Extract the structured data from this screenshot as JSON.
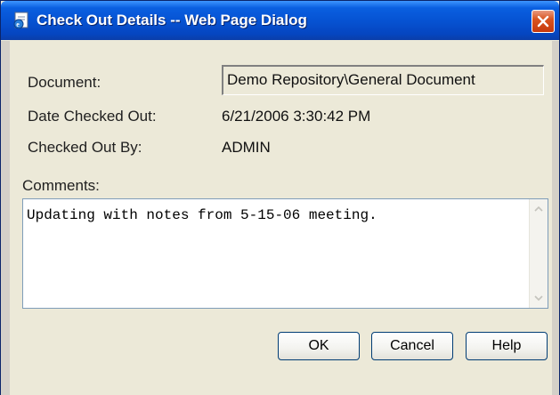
{
  "window": {
    "title": "Check Out Details -- Web Page Dialog"
  },
  "fields": {
    "document_label": "Document:",
    "document_value": "Demo Repository\\General Document",
    "date_label": "Date Checked Out:",
    "date_value": "6/21/2006 3:30:42 PM",
    "by_label": "Checked Out By:",
    "by_value": "ADMIN"
  },
  "comments": {
    "label": "Comments:",
    "value": "Updating with notes from 5-15-06 meeting."
  },
  "buttons": {
    "ok": "OK",
    "cancel": "Cancel",
    "help": "Help"
  },
  "icons": {
    "app": "ie-page-icon",
    "close": "close-icon",
    "scroll_up": "scroll-up-arrow-icon",
    "scroll_down": "scroll-down-arrow-icon"
  },
  "colors": {
    "titlebar": "#0653d3",
    "dialog_bg": "#ece9d8",
    "close_button": "#d9541f"
  }
}
